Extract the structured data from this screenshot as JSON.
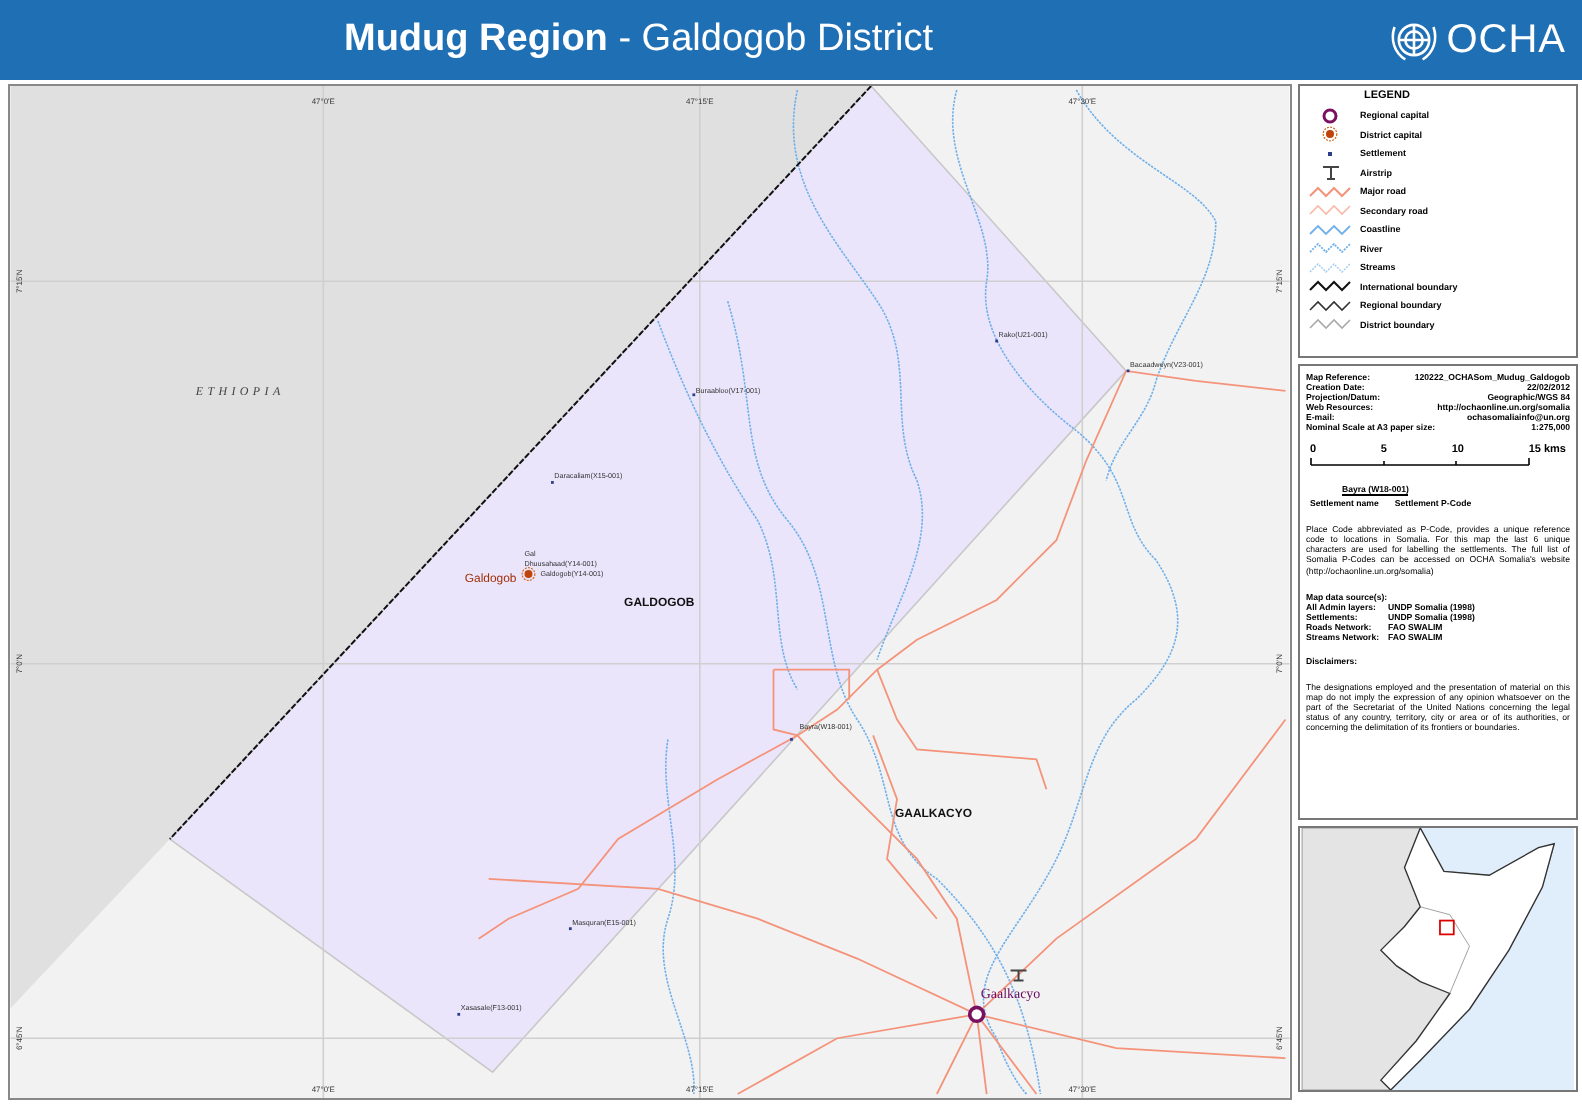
{
  "header": {
    "title": "**Mudug Region** - Galdogob District",
    "logo_text": "OCHA"
  },
  "map": {
    "grid_labels": {
      "top": [
        "47°0'E",
        "47°15'E",
        "47°30'E"
      ],
      "bottom": [
        "47°0'E",
        "47°15'E",
        "47°30'E"
      ],
      "left": [
        "7°15'N",
        "7°0'N",
        "6°45'N"
      ],
      "right": [
        "7°15'N",
        "7°0'N",
        "6°45'N"
      ]
    },
    "country_label": "ETHIOPIA",
    "district_labels": [
      "GALDOGOB",
      "GAALKACYO"
    ],
    "places": [
      {
        "text": "Daracaliam(X15-001)",
        "kind": "settlement"
      },
      {
        "text": "Gal",
        "kind": "label"
      },
      {
        "text": "Dhuusahaad(Y14-001)",
        "kind": "label"
      },
      {
        "text": "Galdogob",
        "kind": "district_capital"
      },
      {
        "text": "Galdogob(Y14-001)",
        "kind": "label"
      },
      {
        "text": "Buraabloo(V17-001)",
        "kind": "settlement"
      },
      {
        "text": "Rako(U21-001)",
        "kind": "settlement"
      },
      {
        "text": "Bacaadweyn(V23-001)",
        "kind": "settlement"
      },
      {
        "text": "Bayra(W18-001)",
        "kind": "settlement"
      },
      {
        "text": "Masquran(E15-001)",
        "kind": "settlement"
      },
      {
        "text": "Xasasale(F13-001)",
        "kind": "settlement"
      },
      {
        "text": "Gaalkacyo",
        "kind": "regional_capital"
      }
    ]
  },
  "legend": {
    "title": "LEGEND",
    "items": [
      {
        "label": "Regional capital",
        "kind": "regional_capital"
      },
      {
        "label": "District capital",
        "kind": "district_capital"
      },
      {
        "label": "Settlement",
        "kind": "settlement"
      },
      {
        "label": "Airstrip",
        "kind": "airstrip"
      },
      {
        "label": "Major road",
        "kind": "major_road"
      },
      {
        "label": "Secondary road",
        "kind": "secondary_road"
      },
      {
        "label": "Coastline",
        "kind": "coastline"
      },
      {
        "label": "River",
        "kind": "river"
      },
      {
        "label": "Streams",
        "kind": "stream"
      },
      {
        "label": "International boundary",
        "kind": "international_boundary"
      },
      {
        "label": "Regional boundary",
        "kind": "regional_boundary"
      },
      {
        "label": "District boundary",
        "kind": "district_boundary"
      }
    ]
  },
  "info": {
    "rows": [
      {
        "label": "Map Reference:",
        "value": "120222_OCHASom_Mudug_Galdogob"
      },
      {
        "label": "Creation Date:",
        "value": "22/02/2012"
      },
      {
        "label": "Projection/Datum:",
        "value": "Geographic/WGS 84"
      },
      {
        "label": "Web Resources:",
        "value": "http://ochaonline.un.org/somalia"
      },
      {
        "label": "E-mail:",
        "value": "ochasomaliainfo@un.org"
      },
      {
        "label": "Nominal Scale at A3 paper size:",
        "value": "1:275,000"
      }
    ],
    "scale_labels": [
      "0",
      "5",
      "10",
      "15 kms"
    ],
    "pcode_example": {
      "sample": "Bayra (W18-001)",
      "name_label": "Settlement name",
      "code_label": "Settlement P-Code"
    },
    "pcode_note": "Place Code abbreviated as P-Code, provides a unique reference code to locations in Somalia. For this map the last 6 unique characters are used for labelling the settlements. The full list of Somalia P-Codes can be accessed on OCHA Somalia's website (http://ochaonline.un.org/somalia)",
    "sources_title": "Map data source(s):",
    "sources": [
      {
        "label": "All Admin layers:",
        "value": "UNDP Somalia (1998)"
      },
      {
        "label": "Settlements:",
        "value": "UNDP Somalia (1998)"
      },
      {
        "label": "Roads Network:",
        "value": "FAO SWALIM"
      },
      {
        "label": "Streams Network:",
        "value": "FAO SWALIM"
      }
    ],
    "disclaimer_title": "Disclaimers:",
    "disclaimer": "The designations employed and the presentation of material on this map do not imply the expression of any opinion whatsoever on the part of the Secretariat of the United Nations concerning the legal status of any country, territory, city or area or of its authorities, or concerning the delimitation of its frontiers or boundaries."
  }
}
